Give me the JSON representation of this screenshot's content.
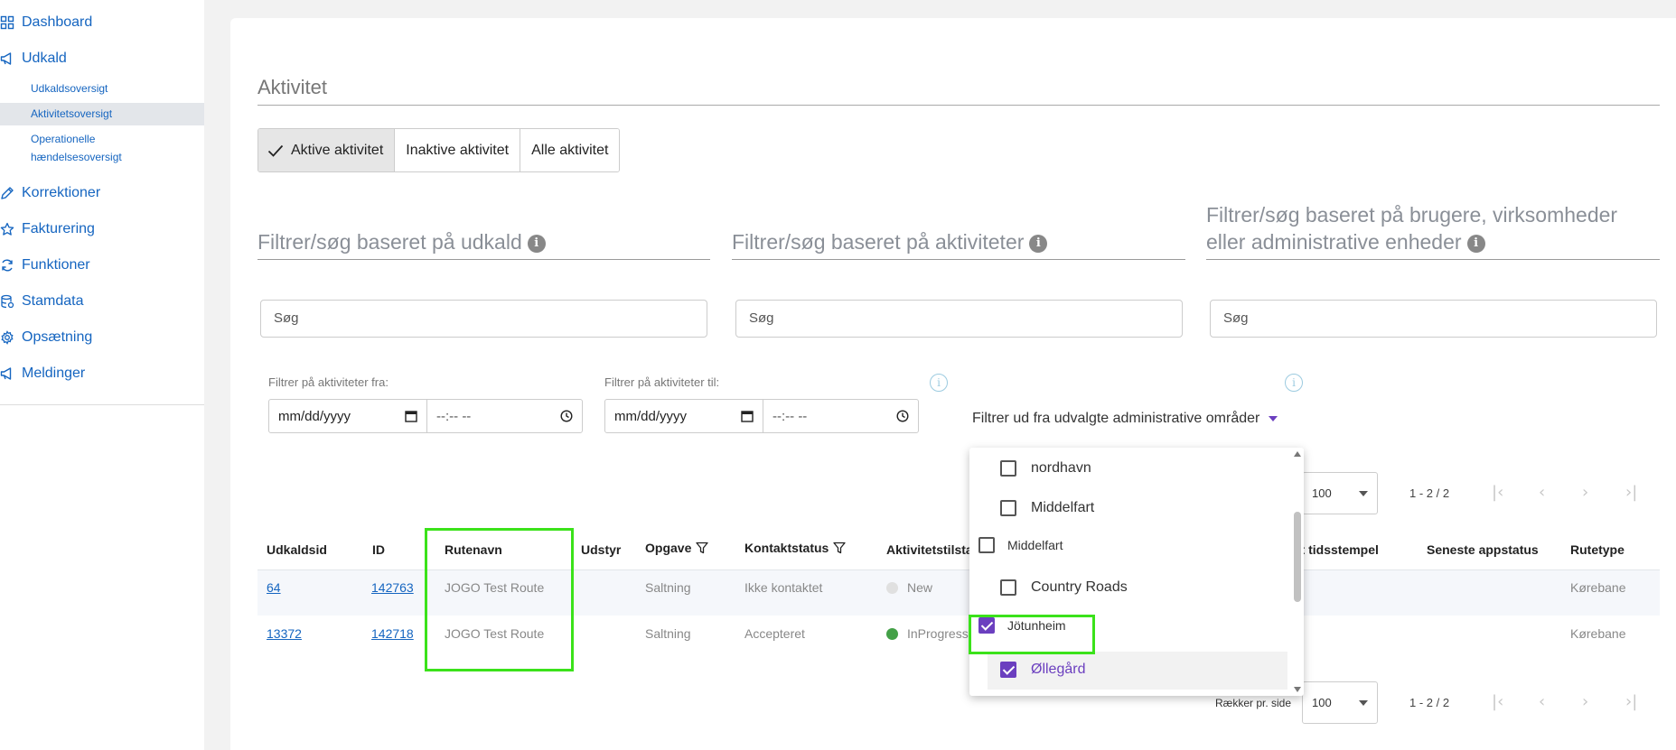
{
  "sidebar": {
    "items": [
      {
        "label": "Dashboard",
        "icon": "grid-icon"
      },
      {
        "label": "Udkald",
        "icon": "megaphone-icon"
      },
      {
        "label": "Korrektioner",
        "icon": "pencil-icon"
      },
      {
        "label": "Fakturering",
        "icon": "star-icon"
      },
      {
        "label": "Funktioner",
        "icon": "refresh-icon"
      },
      {
        "label": "Stamdata",
        "icon": "database-icon"
      },
      {
        "label": "Opsætning",
        "icon": "gear-icon"
      },
      {
        "label": "Meldinger",
        "icon": "megaphone-icon"
      }
    ],
    "sub_items": [
      {
        "label": "Udkaldsoversigt"
      },
      {
        "label": "Aktivitetsoversigt"
      },
      {
        "label_line1": "Operationelle",
        "label_line2": "hændelsesoversigt"
      }
    ]
  },
  "page": {
    "title": "Aktivitet",
    "toggle_buttons": [
      "Aktive aktivitet",
      "Inaktive aktivitet",
      "Alle aktivitet"
    ]
  },
  "filters": {
    "udkald_label": "Filtrer/søg baseret på udkald",
    "aktiviteter_label": "Filtrer/søg baseret på aktiviteter",
    "brugere_label_line1": "Filtrer/søg baseret på brugere, virksomheder",
    "brugere_label_line2": "eller administrative enheder",
    "info_glyph": "i",
    "search_placeholder": "Søg",
    "date_from_label": "Filtrer på aktiviteter fra:",
    "date_to_label": "Filtrer på aktiviteter til:",
    "date_placeholder": "mm/dd/yyyy",
    "time_placeholder": "--:-- --",
    "admin_filter_label": "Filtrer ud fra udvalgte administrative områder"
  },
  "table": {
    "headers": {
      "udkaldsid": "Udkaldsid",
      "id": "ID",
      "rutenavn": "Rutenavn",
      "udstyr": "Udstyr",
      "opgave": "Opgave",
      "kontaktstatus": "Kontaktstatus",
      "aktivitetstilstand": "Aktivitetstilstand",
      "tidsstempel": "dt tidsstempel",
      "appstatus": "Seneste appstatus",
      "rutetype": "Rutetype"
    },
    "rows": [
      {
        "udkaldsid": "64",
        "id": "142763",
        "rutenavn": "JOGO Test Route",
        "opgave": "Saltning",
        "kontaktstatus": "Ikke kontaktet",
        "status": "New",
        "status_color": "#e0e0e0",
        "rutetype": "Kørebane"
      },
      {
        "udkaldsid": "13372",
        "id": "142718",
        "rutenavn": "JOGO Test Route",
        "opgave": "Saltning",
        "kontaktstatus": "Accepteret",
        "status": "InProgress",
        "status_color": "#43a047",
        "rutetype": "Kørebane"
      }
    ]
  },
  "pagination": {
    "rows_per_page_label": "Rækker pr. side",
    "rows_per_page": "100",
    "range": "1 - 2 / 2",
    "first": "|‹",
    "prev": "‹",
    "next": "›",
    "last": "›|"
  },
  "dropdown": {
    "options": [
      {
        "label": "nordhavn",
        "checked": false
      },
      {
        "label": "Middelfart",
        "checked": false
      },
      {
        "label": "Middelfart",
        "checked": false
      },
      {
        "label": "Country Roads",
        "checked": false
      },
      {
        "label": "Jötunheim",
        "checked": true
      },
      {
        "label": "Øllegård",
        "checked": true
      }
    ],
    "accent_color": "#6b3fbf"
  },
  "colors": {
    "link": "#1565c0",
    "highlight": "#3be21a",
    "accent": "#6b3fbf"
  }
}
